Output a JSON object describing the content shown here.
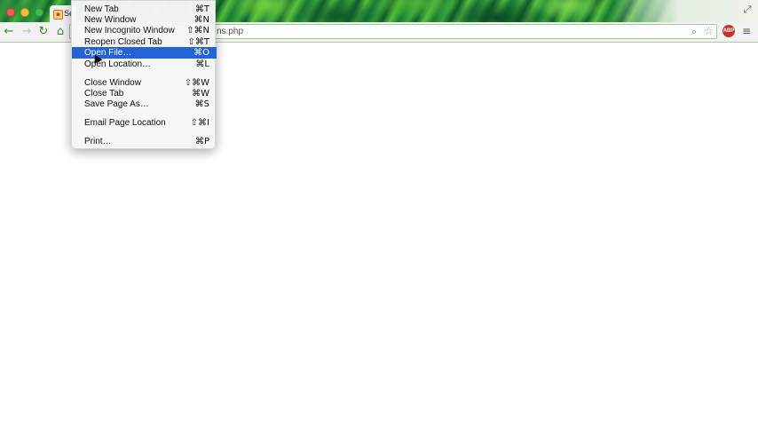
{
  "tab": {
    "title": "Se",
    "favicon": "php-icon"
  },
  "omnibox": {
    "url": "ns.php"
  },
  "menu": {
    "items": [
      {
        "label": "New Tab",
        "shortcut": "⌘T"
      },
      {
        "label": "New Window",
        "shortcut": "⌘N"
      },
      {
        "label": "New Incognito Window",
        "shortcut": "⇧⌘N"
      },
      {
        "label": "Reopen Closed Tab",
        "shortcut": "⇧⌘T"
      },
      {
        "label": "Open File…",
        "shortcut": "⌘O",
        "selected": true
      },
      {
        "label": "Open Location…",
        "shortcut": "⌘L"
      },
      {
        "label": "Close Window",
        "shortcut": "⇧⌘W"
      },
      {
        "label": "Close Tab",
        "shortcut": "⌘W"
      },
      {
        "label": "Save Page As…",
        "shortcut": "⌘S"
      },
      {
        "label": "Email Page Location",
        "shortcut": "⇧⌘I"
      },
      {
        "label": "Print…",
        "shortcut": "⌘P"
      }
    ]
  },
  "toolbar": {
    "abp_label": "ABP"
  },
  "colors": {
    "selection": "#2463d6",
    "accent_green": "#3b8a2e"
  }
}
